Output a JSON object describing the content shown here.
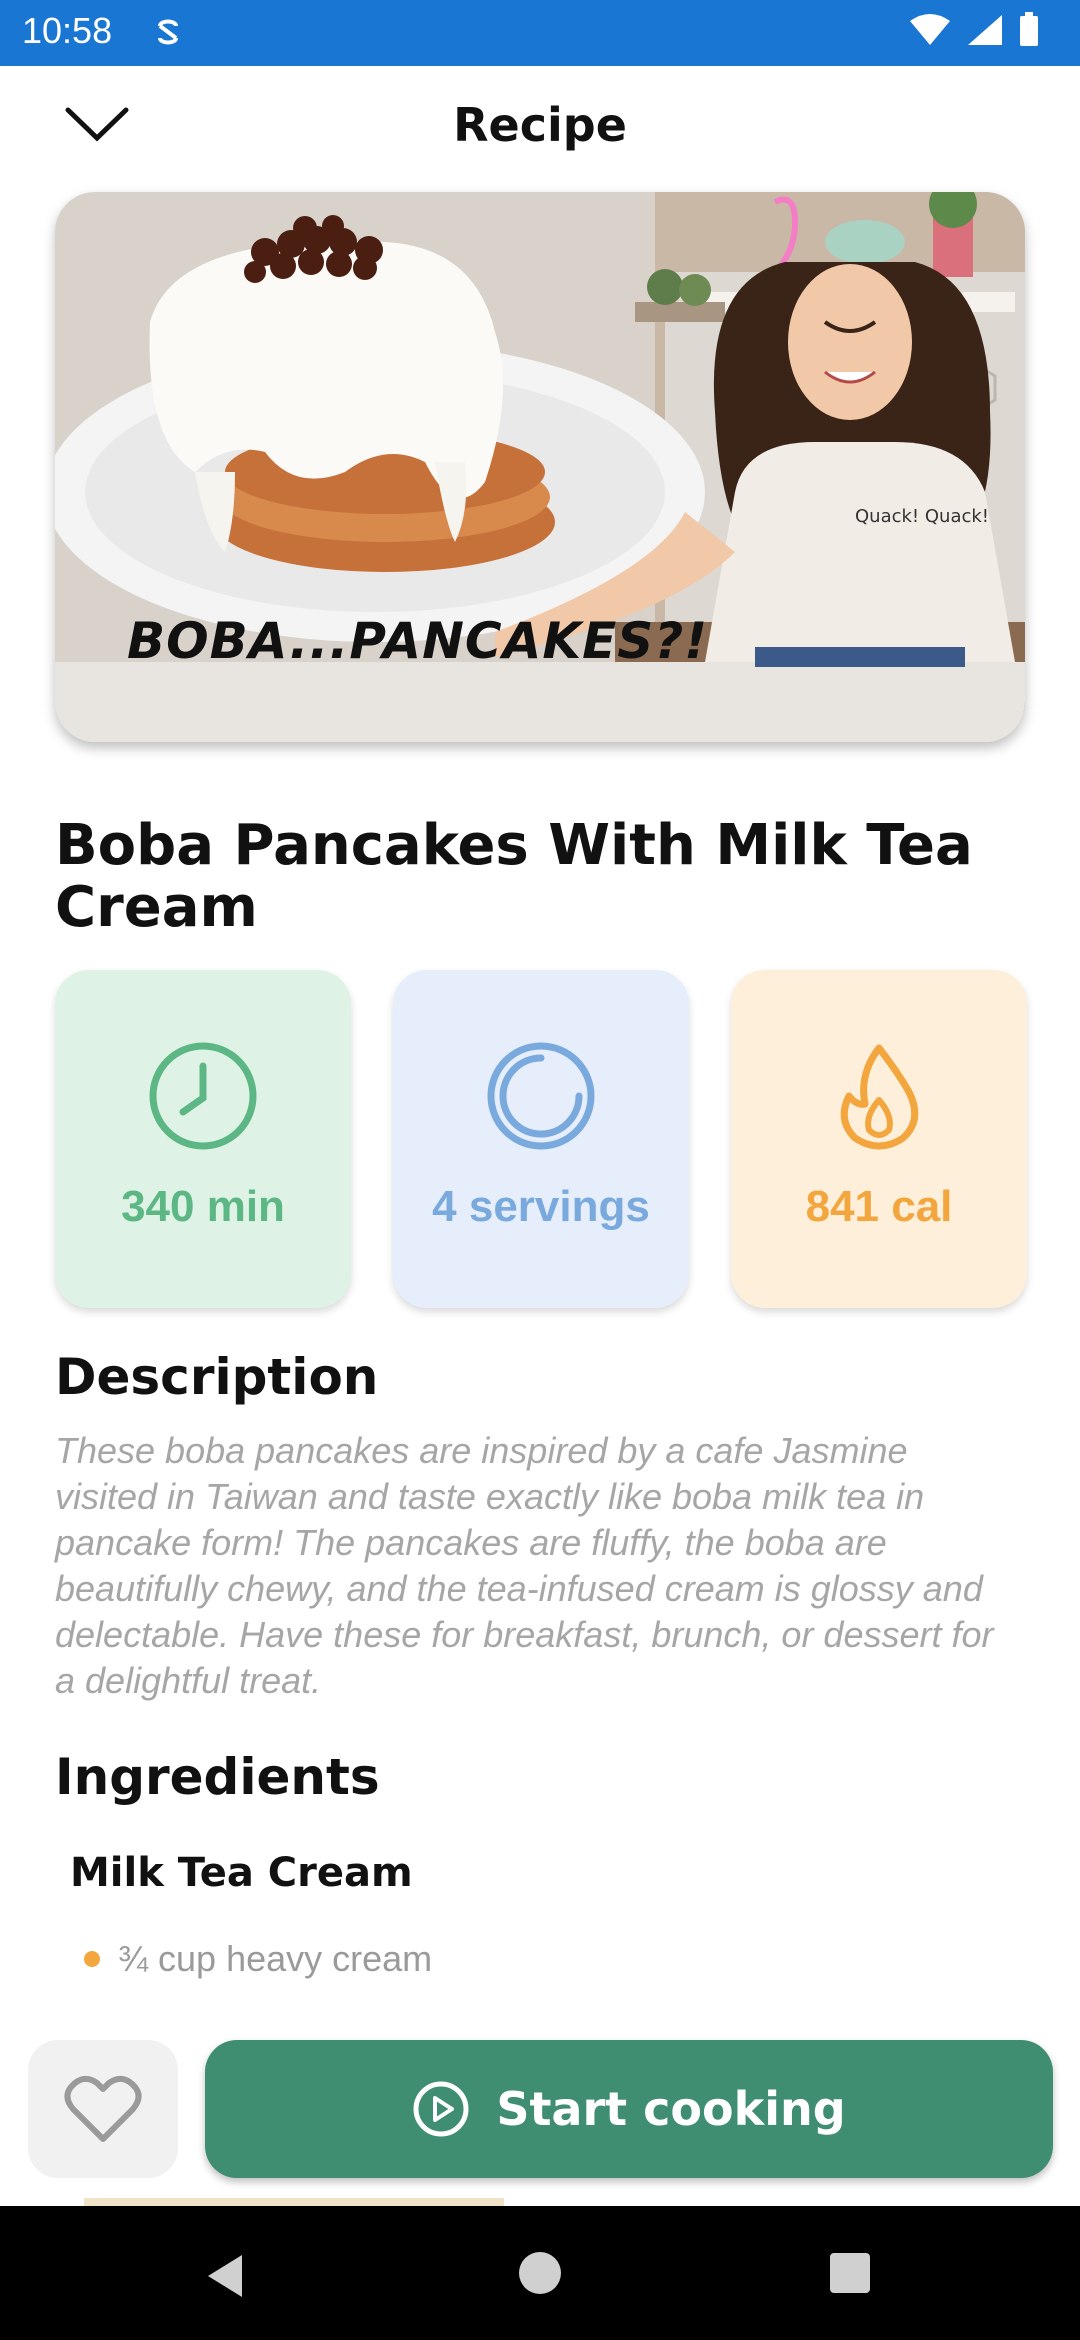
{
  "status_bar": {
    "time": "10:58"
  },
  "header": {
    "title": "Recipe"
  },
  "hero": {
    "overlay_text": "BOBA...PANCAKES?!",
    "shirt_text": "Quack! Quack!"
  },
  "recipe": {
    "title": "Boba Pancakes With Milk Tea Cream",
    "stats": {
      "time": "340 min",
      "servings": "4 servings",
      "calories": "841 cal"
    },
    "description_heading": "Description",
    "description": "These boba pancakes are inspired by a cafe Jasmine visited in Taiwan and taste exactly like  boba milk tea in pancake form! The pancakes are fluffy, the boba are beautifully chewy, and the tea-infused cream is glossy and delectable. Have these for breakfast, brunch, or dessert for a delightful treat.",
    "ingredients_heading": "Ingredients",
    "ingredient_groups": [
      {
        "name": "Milk Tea Cream",
        "items": [
          "¾ cup heavy cream"
        ]
      }
    ]
  },
  "actions": {
    "start_label": "Start cooking"
  },
  "colors": {
    "status_bar": "#1976d2",
    "time_card": "#dff2e6",
    "servings_card": "#e5eefa",
    "calories_card": "#fdefd9",
    "start_button": "#3f8e72",
    "bullet": "#f3a63d"
  }
}
